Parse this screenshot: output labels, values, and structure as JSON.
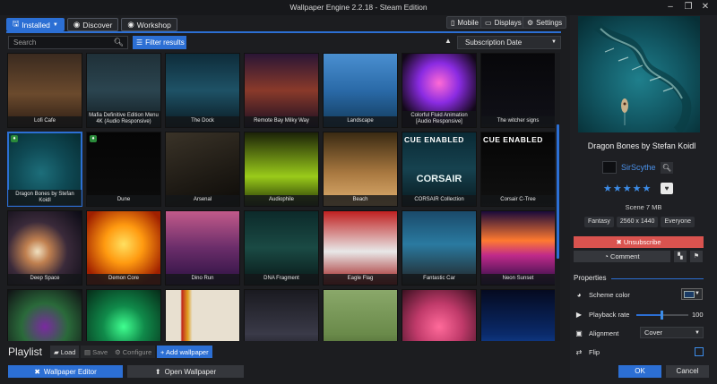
{
  "window": {
    "title": "Wallpaper Engine 2.2.18 - Steam Edition",
    "controls": [
      "–",
      "❐",
      "✕"
    ]
  },
  "top_tabs": [
    {
      "label": "Installed",
      "icon": "disk-icon",
      "active": true
    },
    {
      "label": "Discover",
      "icon": "compass-icon",
      "active": false
    },
    {
      "label": "Workshop",
      "icon": "steam-icon",
      "active": false
    }
  ],
  "top_right_buttons": [
    {
      "label": "Mobile",
      "icon": "mobile-icon"
    },
    {
      "label": "Displays",
      "icon": "monitor-icon"
    },
    {
      "label": "Settings",
      "icon": "gear-icon"
    }
  ],
  "search": {
    "placeholder": "Search"
  },
  "filter_button": {
    "label": "Filter results"
  },
  "sort": {
    "selected": "Subscription Date",
    "direction": "▲"
  },
  "grid": {
    "items": [
      {
        "title": "Lofi Cafe",
        "bg": "linear-gradient(180deg,#3a2a1f 0%,#6b4a2d 55%,#2a1c14 100%)"
      },
      {
        "title": "Mafia Definitive Edition Menu 4K (Audio Responsive)",
        "bg": "linear-gradient(180deg,#1f3038 0%,#2b4550 50%,#10191e 100%)"
      },
      {
        "title": "The Dock",
        "bg": "linear-gradient(180deg,#0e2c3a 0%,#1e5266 50%,#0a1a22 100%)"
      },
      {
        "title": "Remote Bay Milky Way",
        "bg": "linear-gradient(180deg,#2a1535 0%,#8a3a2a 50%,#1a0e22 100%)"
      },
      {
        "title": "Landscape",
        "bg": "linear-gradient(180deg,#4a8fd0 0%,#2a6aa8 50%,#123a5a 100%)"
      },
      {
        "title": "Colorful Fluid Animation [Audio Responsive]",
        "bg": "radial-gradient(circle at 50% 40%,#ff6ad5 0%,#8a2be2 35%,#120818 75%)"
      },
      {
        "title": "The witcher signs",
        "bg": "linear-gradient(180deg,#07070a 0%,#111118 100%)"
      },
      {
        "title": "Dragon Bones by Stefan Koidl",
        "bg": "radial-gradient(circle at 45% 55%,#1d6e7a 0%,#0f4a55 45%,#062a30 100%)",
        "badge": true,
        "selected": true
      },
      {
        "title": "Dune",
        "bg": "linear-gradient(180deg,#050505 0%,#0c0c0c 100%)",
        "badge": true
      },
      {
        "title": "Arsenal",
        "bg": "linear-gradient(160deg,#3a3328 0%,#1e1a14 60%,#0d0b08 100%)"
      },
      {
        "title": "Audiophile",
        "bg": "linear-gradient(180deg,#1b2208 0%,#9acb1a 60%,#203006 100%)"
      },
      {
        "title": "Beach",
        "bg": "linear-gradient(180deg,#3a2a12 0%,#a87840 55%,#e0b070 100%)"
      },
      {
        "title": "CORSAIR Collection",
        "bg": "linear-gradient(180deg,#0a2a35 0%,#16424f 50%,#08181e 100%)",
        "cue": "CUE ENABLED",
        "brand": "CORSAIR"
      },
      {
        "title": "Corsair C-Tree",
        "bg": "linear-gradient(180deg,#050505 0%,#111 100%)",
        "cue": "CUE ENABLED"
      },
      {
        "title": "Deep Space",
        "bg": "radial-gradient(circle at 40% 55%,#f0e0c0 0%,#c08050 20%,#3a2a3a 50%,#0a0a14 100%)"
      },
      {
        "title": "Demon Core",
        "bg": "radial-gradient(circle at 50% 45%,#ffe060 0%,#ff9a10 35%,#a02000 80%)"
      },
      {
        "title": "Dino Run",
        "bg": "linear-gradient(180deg,#c25a8a 0%,#6a2d6a 50%,#2a1040 100%)"
      },
      {
        "title": "DNA Fragment",
        "bg": "linear-gradient(180deg,#0c2a2a 0%,#1a4a44 50%,#081616 100%)"
      },
      {
        "title": "Eagle Flag",
        "bg": "linear-gradient(180deg,#c02020 0%,#e8e8e8 55%,#a01818 100%)"
      },
      {
        "title": "Fantastic Car",
        "bg": "linear-gradient(180deg,#1a4a6a 0%,#2a7aa0 45%,#222 100%)"
      },
      {
        "title": "Neon Sunset",
        "bg": "linear-gradient(180deg,#1a0a3a 0%,#ff7a30 40%,#c02a8a 60%,#200a40 100%)"
      },
      {
        "title": "",
        "bg": "radial-gradient(circle at 50% 50%,#7a2aa0 0%,#2a6a3a 45%,#101014 100%)"
      },
      {
        "title": "",
        "bg": "radial-gradient(circle at 50% 50%,#40ff90 0%,#108a4a 40%,#062a18 100%)"
      },
      {
        "title": "",
        "bg": "linear-gradient(90deg,#e8e0d0 0%,#e8e0d0 20%,#c02a1a 22%,#e0a020 30%,#e8e0d0 36%,#e8e0d0 100%)"
      },
      {
        "title": "",
        "bg": "linear-gradient(180deg,#1a1a20 0%,#3a3a48 60%,#0a0a10 100%)"
      },
      {
        "title": "",
        "bg": "linear-gradient(180deg,#8aa86a 0%,#6a8a4a 60%,#3a5028 100%)"
      },
      {
        "title": "",
        "bg": "radial-gradient(circle at 50% 50%,#ff6a9a 0%,#c03a6a 45%,#3a1020 100%)"
      },
      {
        "title": "",
        "bg": "linear-gradient(180deg,#050a20 0%,#0a2a6a 60%,#1a5ac0 100%)"
      }
    ]
  },
  "playlist": {
    "label": "Playlist",
    "load": "Load",
    "save": "Save",
    "configure": "Configure",
    "add": "+ Add wallpaper"
  },
  "bottom": {
    "editor": "Wallpaper Editor",
    "open": "Open Wallpaper"
  },
  "details": {
    "title": "Dragon Bones by Stefan Koidl",
    "author": "SirScythe",
    "rating_stars": "★★★★★",
    "meta": "Scene 7 MB",
    "tags": [
      "Fantasy",
      "2560 x 1440",
      "Everyone"
    ],
    "unsubscribe": "✖ Unsubscribe",
    "comment": "Comment",
    "properties_title": "Properties",
    "properties": [
      {
        "label": "Scheme color",
        "icon": "palette-icon"
      },
      {
        "label": "Playback rate",
        "icon": "play-icon",
        "value": "100"
      },
      {
        "label": "Alignment",
        "icon": "align-icon",
        "value": "Cover"
      },
      {
        "label": "Flip",
        "icon": "flip-icon"
      }
    ],
    "ok": "OK",
    "cancel": "Cancel"
  },
  "colors": {
    "accent": "#2c6fd4",
    "danger": "#d9534f",
    "link": "#4a90e8"
  }
}
